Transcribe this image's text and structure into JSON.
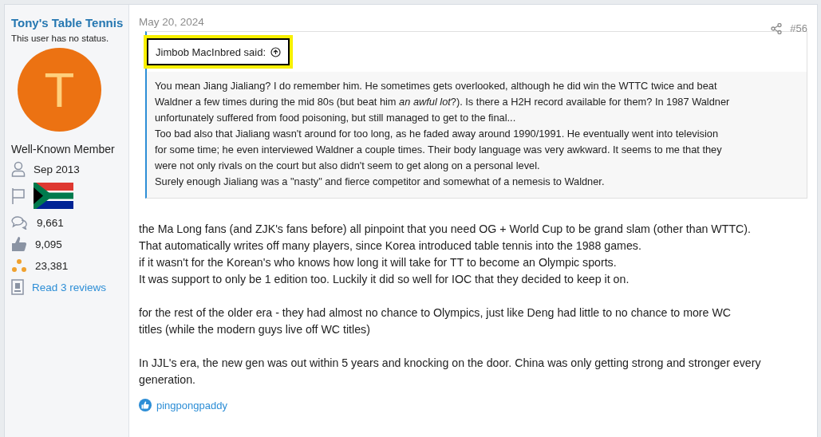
{
  "author": {
    "name": "Tony's Table Tennis",
    "status": "This user has no status.",
    "avatar_letter": "T",
    "title": "Well-Known Member",
    "joined": "Sep 2013",
    "stats": [
      {
        "kind": "messages",
        "text": "9,661"
      },
      {
        "kind": "reactions",
        "text": "9,095"
      },
      {
        "kind": "points",
        "text": "23,381"
      },
      {
        "kind": "reviews",
        "text": "Read 3 reviews"
      }
    ]
  },
  "post": {
    "date": "May 20, 2024",
    "number": "#56",
    "quote": {
      "attribution": "Jimbob MacInbred said:",
      "highlighted": true,
      "lines": [
        "You mean Jiang Jialiang? I do remember him. He sometimes gets overlooked, although he did win the WTTC twice and beat",
        "Waldner a few times during the mid 80s (but beat him *an awful lot*?). Is there a H2H record available for them? In 1987 Waldner",
        "unfortunately suffered from food poisoning, but still managed to get to the final...",
        "Too bad also that Jialiang wasn't around for too long, as he faded away around 1990/1991. He eventually went into television",
        "for some time; he even interviewed Waldner a couple times. Their body language was very awkward. It seems to me that they",
        "were not only rivals on the court but also didn't seem to get along on a personal level.",
        "Surely enough Jialiang was a \"nasty\" and fierce competitor and somewhat of a nemesis to Waldner."
      ]
    },
    "paragraphs": [
      [
        "the Ma Long fans (and ZJK's fans before) all pinpoint that you need OG + World Cup to be grand slam (other than WTTC).",
        "That automatically writes off many players, since Korea introduced table tennis into the 1988 games.",
        "if it wasn't for the Korean's who knows how long it will take for TT to become an Olympic sports.",
        "It was support to only be 1 edition too. Luckily it did so well for IOC that they decided to keep it on."
      ],
      [
        "for the rest of the older era - they had almost no chance to Olympics, just like Deng had little to no chance to more WC",
        "titles (while the modern guys live off WC titles)"
      ],
      [
        "In JJL's era, the new gen was out within 5 years and knocking on the door. China was only getting strong and stronger every",
        "generation."
      ]
    ],
    "reactions": [
      {
        "kind": "like",
        "user": "pingpongpaddy"
      }
    ]
  }
}
